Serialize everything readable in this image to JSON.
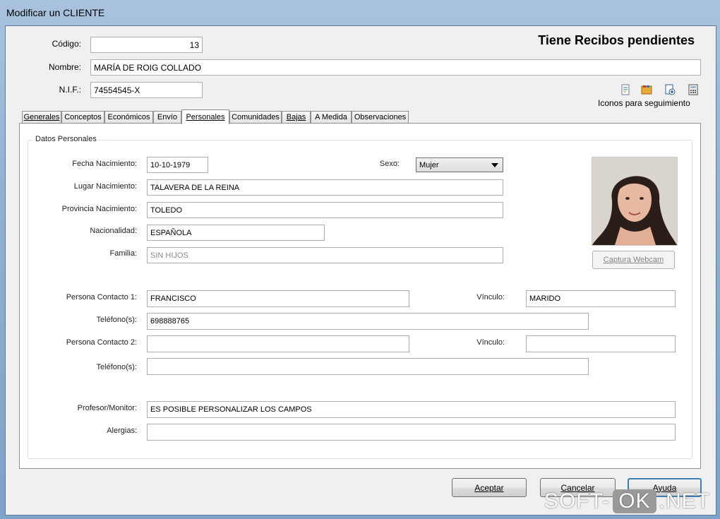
{
  "window": {
    "title": "Modificar un CLIENTE"
  },
  "header": {
    "codigo_label": "Código:",
    "codigo_value": "13",
    "nombre_label": "Nombre:",
    "nombre_value": "MARÍA DE ROIG COLLADO",
    "nif_label": "N.I.F.:",
    "nif_value": "74554545-X",
    "status": "Tiene Recibos pendientes",
    "icons_caption": "Iconos para seguimiento",
    "icons": [
      "document-icon",
      "folder-icon",
      "add-document-icon",
      "calculator-icon"
    ]
  },
  "tabs": [
    {
      "label": "Generales"
    },
    {
      "label": "Conceptos"
    },
    {
      "label": "Económicos"
    },
    {
      "label": "Envío"
    },
    {
      "label": "Personales"
    },
    {
      "label": "Comunidades"
    },
    {
      "label": "Bajas"
    },
    {
      "label": "A Medida"
    },
    {
      "label": "Observaciones"
    }
  ],
  "active_tab": "Personales",
  "personales": {
    "group_title": "Datos Personales",
    "fecha_nacimiento_label": "Fecha Nacimiento:",
    "fecha_nacimiento_value": "10-10-1979",
    "sexo_label": "Sexo:",
    "sexo_value": "Mujer",
    "lugar_nacimiento_label": "Lugar Nacimiento:",
    "lugar_nacimiento_value": "TALAVERA DE LA REINA",
    "provincia_nacimiento_label": "Provincia Nacimiento:",
    "provincia_nacimiento_value": "TOLEDO",
    "nacionalidad_label": "Nacionalidad:",
    "nacionalidad_value": "ESPAÑOLA",
    "familia_label": "Familia:",
    "familia_value": "SIN HIJOS",
    "captura_button": "Captura Webcam",
    "contacto1_label": "Persona Contacto 1:",
    "contacto1_value": "FRANCISCO",
    "vinculo1_label": "Vínculo:",
    "vinculo1_value": "MARIDO",
    "telefono1_label": "Teléfono(s):",
    "telefono1_value": "698888765",
    "contacto2_label": "Persona Contacto 2:",
    "contacto2_value": "",
    "vinculo2_label": "Vínculo:",
    "vinculo2_value": "",
    "telefono2_label": "Teléfono(s):",
    "telefono2_value": "",
    "profesor_label": "Profesor/Monitor:",
    "profesor_value": "ES POSIBLE PERSONALIZAR LOS CAMPOS",
    "alergias_label": "Alergias:",
    "alergias_value": ""
  },
  "footer": {
    "aceptar": "Aceptar",
    "cancelar": "Cancelar",
    "ayuda": "Ayuda"
  },
  "watermark": {
    "left": "SOFT-",
    "box": "OK",
    "right": ".NET"
  }
}
